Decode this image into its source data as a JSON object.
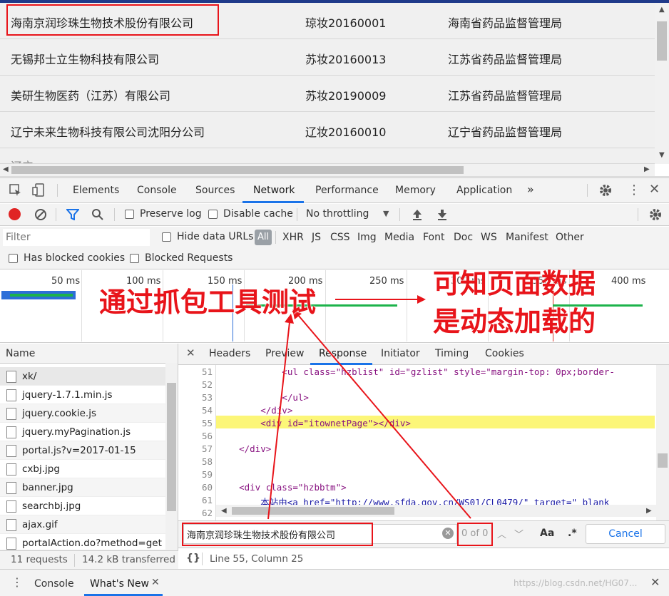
{
  "page_table": {
    "rows": [
      {
        "name": "海南京润珍珠生物技术股份有限公司",
        "license": "琼妆20160001",
        "authority": "海南省药品监督管理局"
      },
      {
        "name": "无锡邦士立生物科技有限公司",
        "license": "苏妆20160013",
        "authority": "江苏省药品监督管理局"
      },
      {
        "name": "美研生物医药（江苏）有限公司",
        "license": "苏妆20190009",
        "authority": "江苏省药品监督管理局"
      },
      {
        "name": "辽宁未来生物科技有限公司沈阳分公司",
        "license": "辽妆20160010",
        "authority": "辽宁省药品监督管理局"
      },
      {
        "name": "辽宁……",
        "license": "",
        "authority": ""
      }
    ]
  },
  "devtools": {
    "tabs": [
      "Elements",
      "Console",
      "Sources",
      "Network",
      "Performance",
      "Memory",
      "Application"
    ],
    "more_tabs": "»",
    "active_tab": "Network",
    "toolbar": {
      "preserve_log": "Preserve log",
      "disable_cache": "Disable cache",
      "throttling": "No throttling"
    },
    "filter": {
      "placeholder": "Filter",
      "hide_data_urls": "Hide data URLs",
      "types": [
        "All",
        "XHR",
        "JS",
        "CSS",
        "Img",
        "Media",
        "Font",
        "Doc",
        "WS",
        "Manifest",
        "Other"
      ],
      "has_blocked_cookies": "Has blocked cookies",
      "blocked_requests": "Blocked Requests"
    },
    "timeline_ticks": [
      "50 ms",
      "100 ms",
      "150 ms",
      "200 ms",
      "250 ms",
      "300 ms",
      "350 ms",
      "400 ms"
    ],
    "names_header": "Name",
    "requests": [
      "xk/",
      "jquery-1.7.1.min.js",
      "jquery.cookie.js",
      "jquery.myPagination.js",
      "portal.js?v=2017-01-15",
      "cxbj.jpg",
      "banner.jpg",
      "searchbj.jpg",
      "ajax.gif",
      "portalAction.do?method=get"
    ],
    "status": {
      "requests": "11 requests",
      "transferred": "14.2 kB transferred"
    },
    "response_tabs": [
      "Headers",
      "Preview",
      "Response",
      "Initiator",
      "Timing",
      "Cookies"
    ],
    "active_response_tab": "Response",
    "code_lines": [
      {
        "n": "51",
        "text": "            <ul class=\"hzblist\" id=\"gzlist\" style=\"margin-top: 0px;border-"
      },
      {
        "n": "52",
        "text": ""
      },
      {
        "n": "53",
        "text": "            </ul>"
      },
      {
        "n": "54",
        "text": "        </div>"
      },
      {
        "n": "55",
        "text": "        <div id=\"itownetPage\"></div>"
      },
      {
        "n": "56",
        "text": ""
      },
      {
        "n": "57",
        "text": "    </div>"
      },
      {
        "n": "58",
        "text": ""
      },
      {
        "n": "59",
        "text": ""
      },
      {
        "n": "60",
        "text": "    <div class=\"hzbbtm\">"
      },
      {
        "n": "61",
        "text": "        本站由<a href=\"http://www.sfda.gov.cn/WS01/CL0479/\" target=\"_blank"
      },
      {
        "n": "62",
        "text": ""
      }
    ],
    "search": {
      "value": "海南京润珍珠生物技术股份有限公司",
      "count": "0 of 0",
      "case_label": "Aa",
      "regex_label": ".*",
      "cancel": "Cancel"
    },
    "cursor_pos": "Line 55, Column 25",
    "format_icon": "{}",
    "drawer": {
      "tabs": [
        "Console",
        "What's New"
      ]
    },
    "watermark": "https://blog.csdn.net/HG07..."
  },
  "annotation": {
    "left": "通过抓包工具测试",
    "right_line1": "可知页面数据",
    "right_line2": "是动态加载的",
    "color": "#e8141a"
  }
}
